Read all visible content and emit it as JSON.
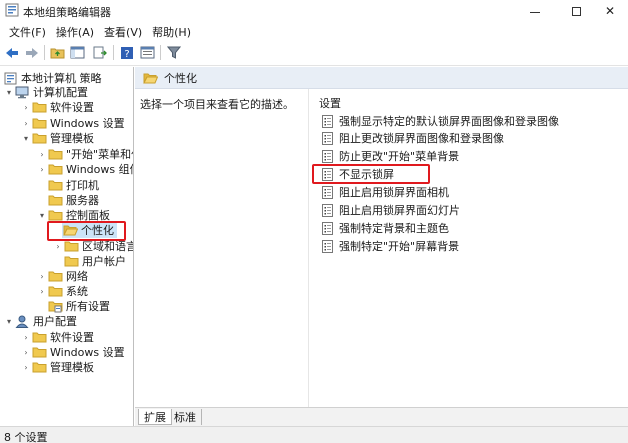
{
  "window": {
    "title": "本地组策略编辑器"
  },
  "menu": [
    "文件(F)",
    "操作(A)",
    "查看(V)",
    "帮助(H)"
  ],
  "tree": {
    "root": "本地计算机 策略",
    "computer_config": "计算机配置",
    "cc_software": "软件设置",
    "cc_windows": "Windows 设置",
    "cc_admin": "管理模板",
    "start_menu": "\"开始\"菜单和任",
    "windows_components": "Windows 组件",
    "printers": "打印机",
    "server": "服务器",
    "control_panel": "控制面板",
    "personalization": "个性化",
    "region": "区域和语言",
    "user_accounts": "用户帐户",
    "network": "网络",
    "system": "系统",
    "all_settings": "所有设置",
    "user_config": "用户配置",
    "uc_software": "软件设置",
    "uc_windows": "Windows 设置",
    "uc_admin": "管理模板"
  },
  "right": {
    "header": "个性化",
    "description": "选择一个项目来查看它的描述。",
    "column": "设置",
    "settings": [
      "强制显示特定的默认锁屏界面图像和登录图像",
      "阻止更改锁屏界面图像和登录图像",
      "防止更改\"开始\"菜单背景",
      "不显示锁屏",
      "阻止启用锁屏界面相机",
      "阻止启用锁屏界面幻灯片",
      "强制特定背景和主题色",
      "强制特定\"开始\"屏幕背景"
    ]
  },
  "tabs": [
    "扩展",
    "标准"
  ],
  "status": "8 个设置",
  "colors": {
    "highlight": "#e0191e",
    "selection": "#cce4f7",
    "header_bg": "#e8eef6"
  }
}
